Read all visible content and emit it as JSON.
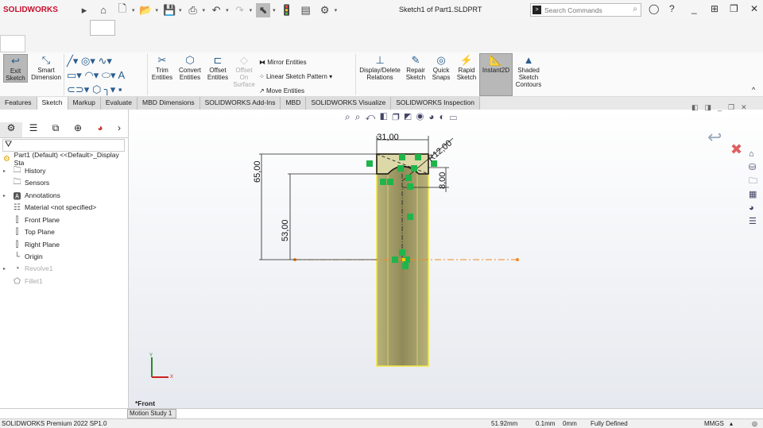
{
  "app": {
    "brand": "SOLIDWORKS",
    "title": "Sketch1 of Part1.SLDPRT",
    "search_placeholder": "Search Commands"
  },
  "ribbon": {
    "exit_sketch": "Exit Sketch",
    "smart_dimension": "Smart Dimension",
    "trim": "Trim Entities",
    "convert": "Convert Entities",
    "offset": "Offset Entities",
    "offset_surface": "Offset On Surface",
    "mirror": "Mirror Entities",
    "linear_pattern": "Linear Sketch Pattern",
    "move": "Move Entities",
    "display_relations": "Display/Delete Relations",
    "repair": "Repair Sketch",
    "quick_snaps": "Quick Snaps",
    "rapid": "Rapid Sketch",
    "instant2d": "Instant2D",
    "shaded": "Shaded Sketch Contours"
  },
  "tabs": [
    "Features",
    "Sketch",
    "Markup",
    "Evaluate",
    "MBD Dimensions",
    "SOLIDWORKS Add-Ins",
    "MBD",
    "SOLIDWORKS Visualize",
    "SOLIDWORKS Inspection"
  ],
  "active_tab": "Sketch",
  "tree": {
    "root": "Part1 (Default) <<Default>_Display Sta",
    "items": [
      {
        "label": "History",
        "icon": "history-folder-icon"
      },
      {
        "label": "Sensors",
        "icon": "sensors-folder-icon"
      },
      {
        "label": "Annotations",
        "icon": "annotations-folder-icon"
      },
      {
        "label": "Material <not specified>",
        "icon": "material-icon"
      },
      {
        "label": "Front Plane",
        "icon": "plane-icon"
      },
      {
        "label": "Top Plane",
        "icon": "plane-icon"
      },
      {
        "label": "Right Plane",
        "icon": "plane-icon"
      },
      {
        "label": "Origin",
        "icon": "origin-icon"
      },
      {
        "label": "Revolve1",
        "icon": "revolve-icon"
      },
      {
        "label": "Fillet1",
        "icon": "fillet-icon"
      }
    ]
  },
  "sketch": {
    "dim_width": "31,00",
    "dim_radius": "R12,00",
    "dim_depth": "8,00",
    "dim_total": "65,00",
    "dim_height": "53,00"
  },
  "view_label": "*Front",
  "motion_tab": "Motion Study 1",
  "status": {
    "product": "SOLIDWORKS Premium 2022 SP1.0",
    "x": "51.92mm",
    "y": "0.1mm",
    "z": "0mm",
    "state": "Fully Defined",
    "units": "MMGS"
  },
  "colors": {
    "accent": "#c8102e",
    "relation": "#1fb54a",
    "centerline": "#f08a24",
    "body": "#a8a06a"
  }
}
